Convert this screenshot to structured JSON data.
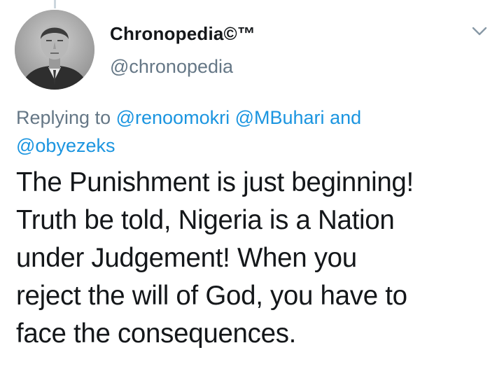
{
  "tweet": {
    "author": {
      "display_name": "Chronopedia©™",
      "handle": "@chronopedia",
      "avatar_icon": "profile-photo"
    },
    "replying_to": {
      "prefix": "Replying to",
      "mentions": [
        "@renoomokri",
        "@MBuhari",
        "@obyezeks"
      ],
      "conjunction": "and"
    },
    "text_lines": [
      "The Punishment is just beginning!",
      "Truth be told, Nigeria is a Nation",
      "under Judgement! When you",
      "reject the will of God, you have to",
      "face the consequences."
    ],
    "menu_icon": "chevron-down-icon"
  },
  "colors": {
    "mention": "#1b95e0",
    "secondary_text": "#657786",
    "primary_text": "#14171a",
    "thread_line": "#ccd6dd"
  }
}
